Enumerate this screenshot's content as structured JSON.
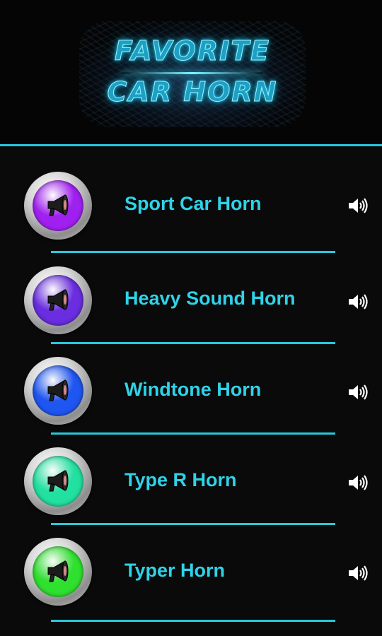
{
  "header": {
    "logo_line1": "FAVORITE",
    "logo_line2": "CAR HORN"
  },
  "colors": {
    "accent": "#27c9dc",
    "label": "#2ed3e8",
    "background": "#0a0a0a"
  },
  "items": [
    {
      "label": "Sport Car Horn",
      "color": "#a020f0",
      "icon": "megaphone-icon"
    },
    {
      "label": "Heavy Sound Horn",
      "color": "#6a2de0",
      "icon": "megaphone-icon"
    },
    {
      "label": "Windtone Horn",
      "color": "#1f55f0",
      "icon": "megaphone-icon"
    },
    {
      "label": "Type R Horn",
      "color": "#22e0a0",
      "icon": "megaphone-icon"
    },
    {
      "label": "Typer Horn",
      "color": "#2fe02f",
      "icon": "megaphone-icon"
    }
  ]
}
